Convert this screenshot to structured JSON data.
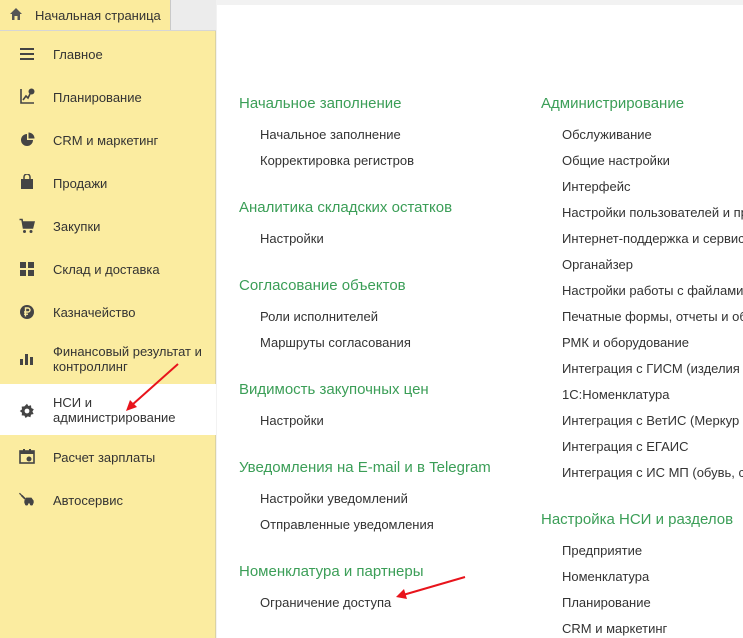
{
  "tab": {
    "label": "Начальная страница"
  },
  "sidebar": {
    "items": [
      {
        "label": "Главное"
      },
      {
        "label": "Планирование"
      },
      {
        "label": "CRM и маркетинг"
      },
      {
        "label": "Продажи"
      },
      {
        "label": "Закупки"
      },
      {
        "label": "Склад и доставка"
      },
      {
        "label": "Казначейство"
      },
      {
        "label1": "Финансовый результат и",
        "label2": "контроллинг"
      },
      {
        "label1": "НСИ и",
        "label2": "администрирование"
      },
      {
        "label": "Расчет зарплаты"
      },
      {
        "label": "Автосервис"
      }
    ]
  },
  "main": {
    "left": [
      {
        "title": "Начальное заполнение",
        "links": [
          "Начальное заполнение",
          "Корректировка регистров"
        ]
      },
      {
        "title": "Аналитика складских остатков",
        "links": [
          "Настройки"
        ]
      },
      {
        "title": "Согласование объектов",
        "links": [
          "Роли исполнителей",
          "Маршруты согласования"
        ]
      },
      {
        "title": "Видимость закупочных цен",
        "links": [
          "Настройки"
        ]
      },
      {
        "title": "Уведомления на E-mail и в Telegram",
        "links": [
          "Настройки уведомлений",
          "Отправленные уведомления"
        ]
      },
      {
        "title": "Номенклатура и партнеры",
        "links": [
          "Ограничение доступа"
        ]
      }
    ],
    "right": [
      {
        "title": "Администрирование",
        "links": [
          "Обслуживание",
          "Общие настройки",
          "Интерфейс",
          "Настройки пользователей и пр",
          "Интернет-поддержка и сервис",
          "Органайзер",
          "Настройки работы с файлами",
          "Печатные формы, отчеты и об",
          "РМК и оборудование",
          "Интеграция с ГИСМ (изделия",
          "1С:Номенклатура",
          "Интеграция с ВетИС (Меркур",
          "Интеграция с ЕГАИС",
          "Интеграция с ИС МП (обувь, с"
        ]
      },
      {
        "title": "Настройка НСИ и разделов",
        "links": [
          "Предприятие",
          "Номенклатура",
          "Планирование",
          "CRM и маркетинг"
        ]
      }
    ]
  },
  "colors": {
    "accent_green": "#3b9e57",
    "sidebar_bg": "#fbeca0",
    "arrow_red": "#e8141c"
  }
}
